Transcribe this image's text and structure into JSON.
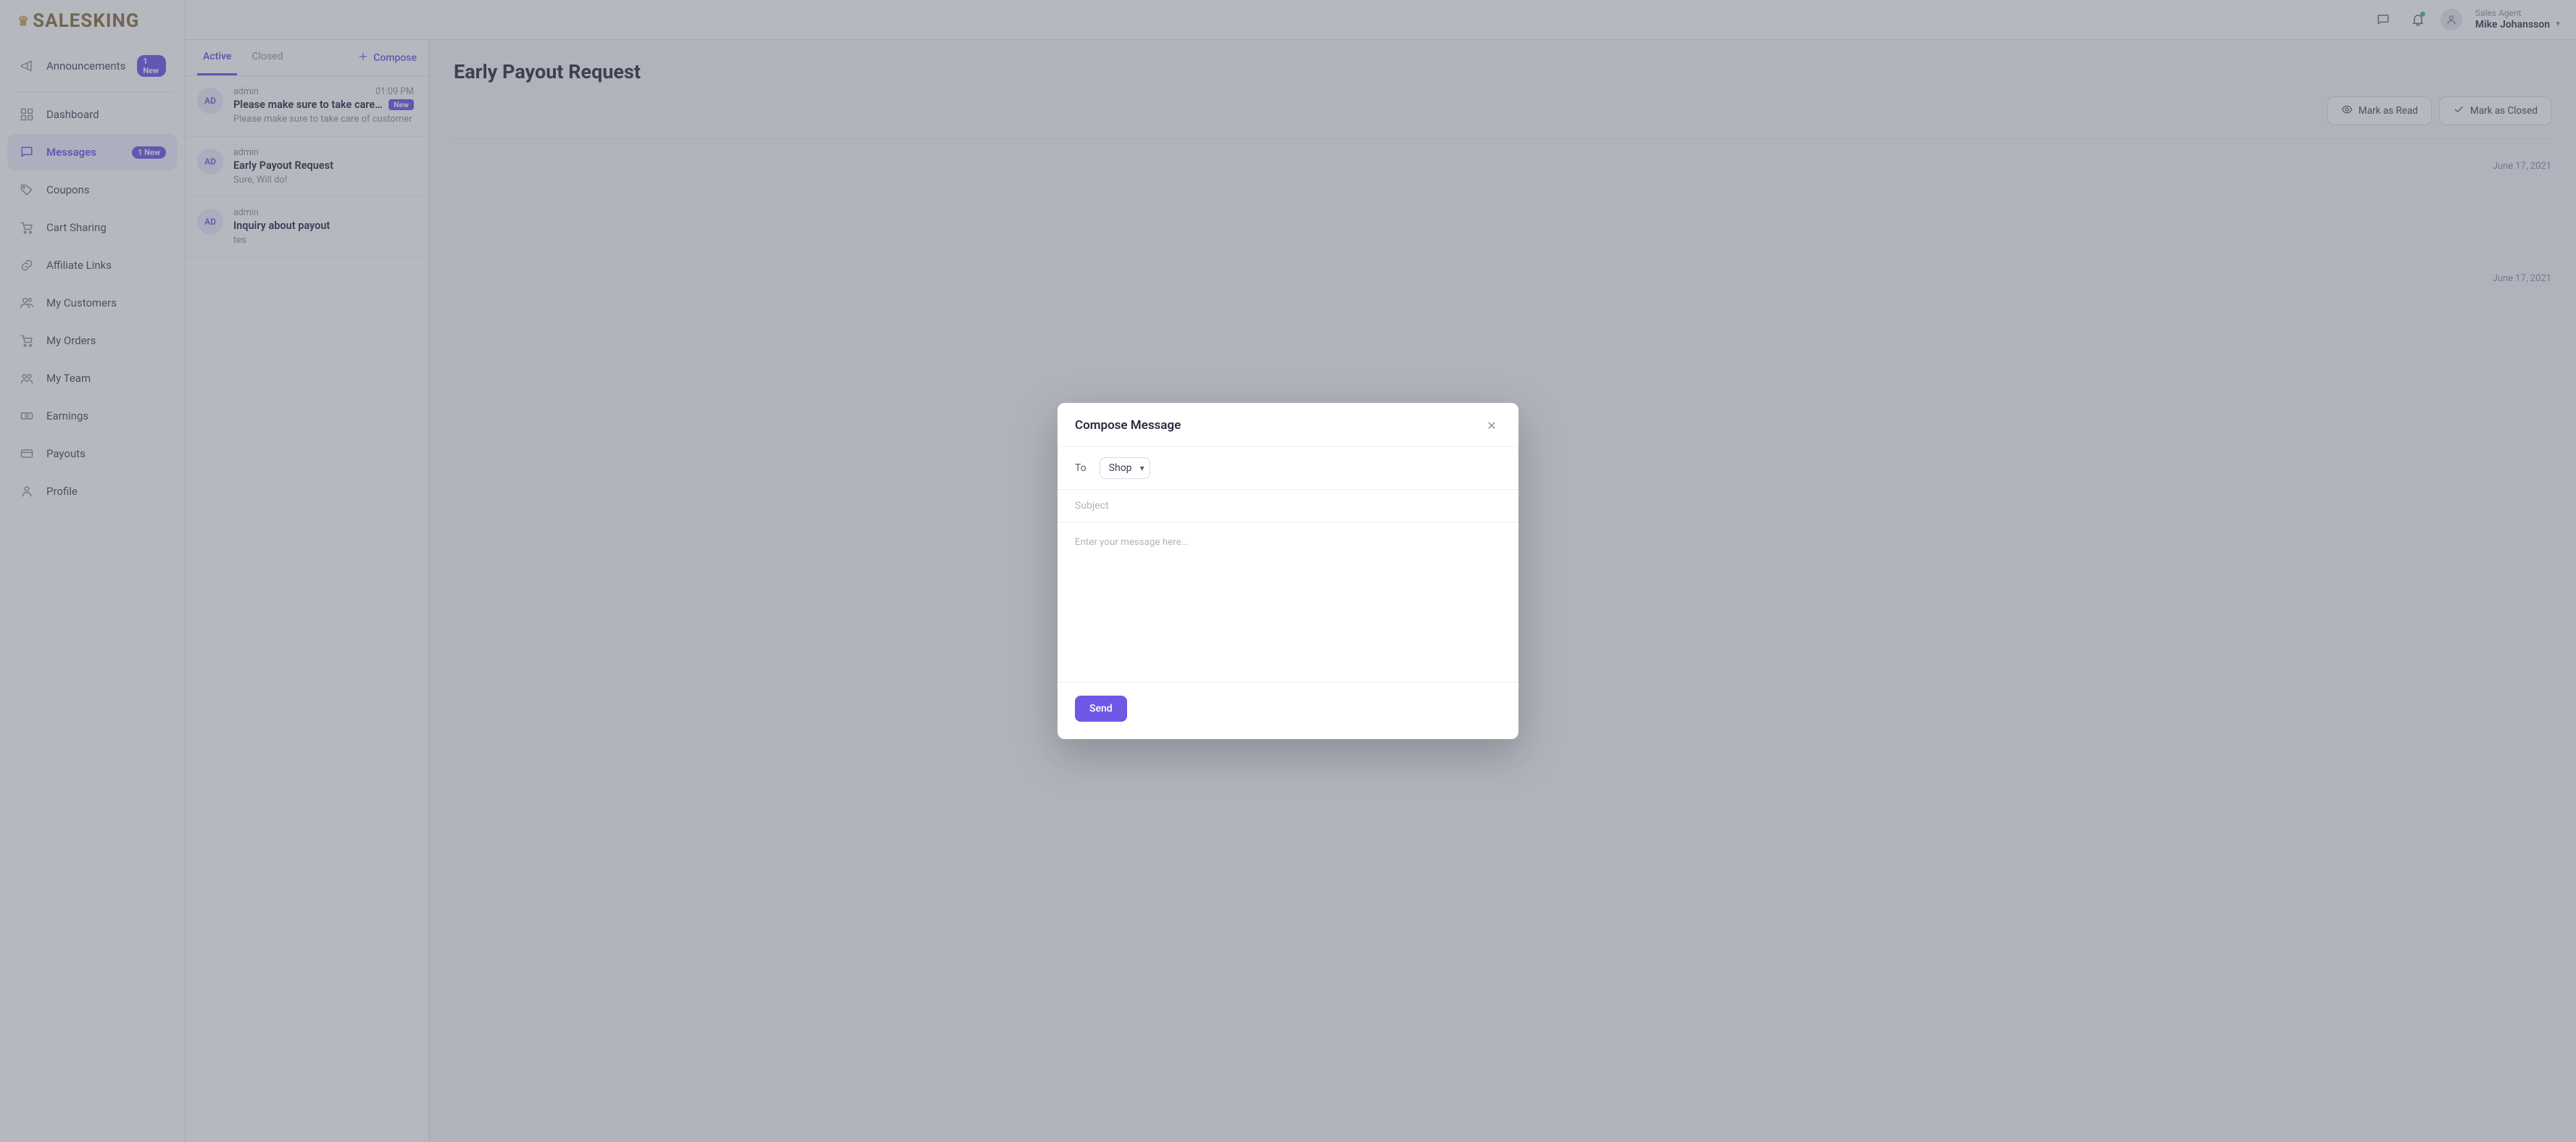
{
  "brand": {
    "name": "SALESKING"
  },
  "topbar": {
    "role": "Sales Agent",
    "user_name": "Mike Johansson"
  },
  "sidebar": {
    "items": [
      {
        "label": "Announcements",
        "badge": "1 New",
        "icon": "megaphone"
      },
      {
        "label": "Dashboard",
        "badge": null,
        "icon": "grid"
      },
      {
        "label": "Messages",
        "badge": "1 New",
        "icon": "chat",
        "active": true
      },
      {
        "label": "Coupons",
        "badge": null,
        "icon": "tag"
      },
      {
        "label": "Cart Sharing",
        "badge": null,
        "icon": "cart"
      },
      {
        "label": "Affiliate Links",
        "badge": null,
        "icon": "link"
      },
      {
        "label": "My Customers",
        "badge": null,
        "icon": "users"
      },
      {
        "label": "My Orders",
        "badge": null,
        "icon": "cart"
      },
      {
        "label": "My Team",
        "badge": null,
        "icon": "team"
      },
      {
        "label": "Earnings",
        "badge": null,
        "icon": "money"
      },
      {
        "label": "Payouts",
        "badge": null,
        "icon": "payout"
      },
      {
        "label": "Profile",
        "badge": null,
        "icon": "profile"
      }
    ]
  },
  "msg_tabs": {
    "active": "Active",
    "closed": "Closed",
    "compose": "Compose"
  },
  "threads": [
    {
      "avatar": "AD",
      "author": "admin",
      "time": "01:09 PM",
      "subject": "Please make sure to take care …",
      "preview": "Please make sure to take care of customer",
      "is_new": true,
      "new_label": "New"
    },
    {
      "avatar": "AD",
      "author": "admin",
      "time": "",
      "subject": "Early Payout Request",
      "preview": "Sure, Will do!",
      "is_new": false
    },
    {
      "avatar": "AD",
      "author": "admin",
      "time": "",
      "subject": "Inquiry about payout",
      "preview": "tes",
      "is_new": false
    }
  ],
  "detail": {
    "title": "Early Payout Request",
    "mark_read": "Mark as Read",
    "mark_closed": "Mark as Closed",
    "dates": [
      "June 17, 2021",
      "June 17, 2021"
    ]
  },
  "modal": {
    "title": "Compose Message",
    "to_label": "To",
    "to_value": "Shop",
    "subject_placeholder": "Subject",
    "body_placeholder": "Enter your message here...",
    "send": "Send"
  }
}
